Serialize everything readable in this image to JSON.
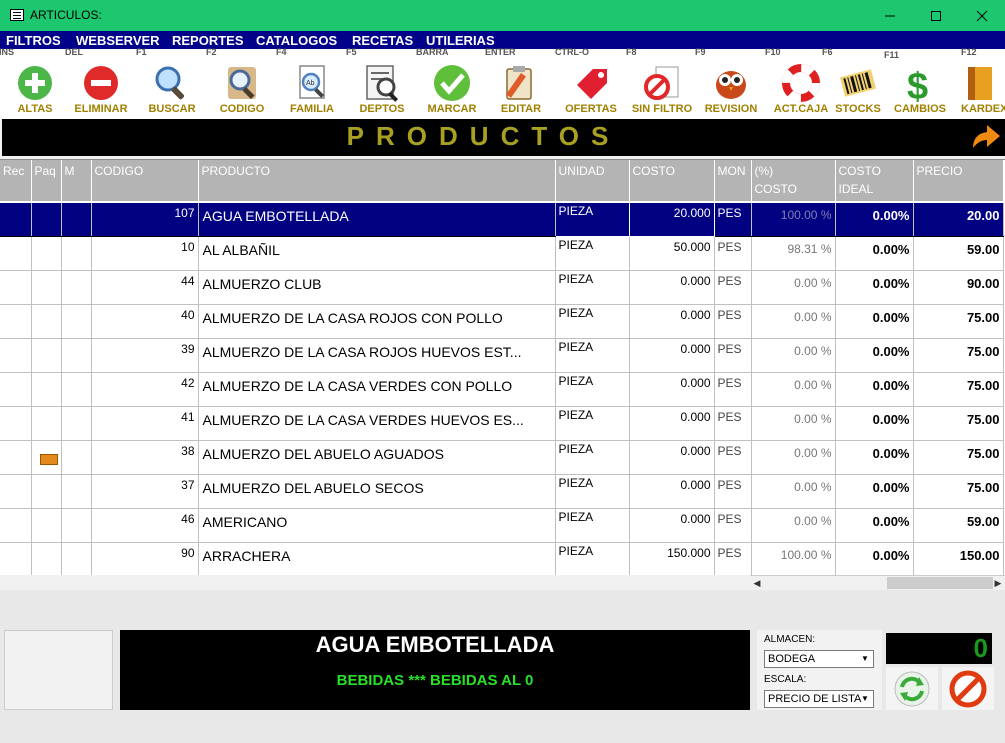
{
  "window": {
    "title": "ARTICULOS:"
  },
  "menu": [
    "FILTROS",
    "WEBSERVER",
    "REPORTES",
    "CATALOGOS",
    "RECETAS",
    "UTILERIAS"
  ],
  "toolbar": [
    {
      "key": "INS",
      "label": "ALTAS"
    },
    {
      "key": "DEL",
      "label": "ELIMINAR"
    },
    {
      "key": "F1",
      "label": "BUSCAR"
    },
    {
      "key": "F2",
      "label": "CODIGO"
    },
    {
      "key": "F4",
      "label": "FAMILIA"
    },
    {
      "key": "F5",
      "label": "DEPTOS"
    },
    {
      "key": "BARRA",
      "label": "MARCAR"
    },
    {
      "key": "ENTER",
      "label": "EDITAR"
    },
    {
      "key": "CTRL-O",
      "label": "OFERTAS"
    },
    {
      "key": "F8",
      "label": "SIN FILTRO"
    },
    {
      "key": "F9",
      "label": "REVISION"
    },
    {
      "key": "F10",
      "label": "ACT.CAJA"
    },
    {
      "key": "F6",
      "label": "STOCKS"
    },
    {
      "key": "F11",
      "label": "CAMBIOS"
    },
    {
      "key": "F12",
      "label": "KARDEX"
    }
  ],
  "header": {
    "title": "PRODUCTOS"
  },
  "columns": [
    "Rec",
    "Paq",
    "M",
    "CODIGO",
    "PRODUCTO",
    "UNIDAD",
    "COSTO",
    "MON",
    "(%)\nCOSTO",
    "COSTO\nIDEAL",
    "PRECIO"
  ],
  "rows": [
    {
      "code": "107",
      "product": "AGUA EMBOTELLADA",
      "unit": "PIEZA",
      "cost": "20.000",
      "mon": "PES",
      "pct": "100.00 %",
      "ideal": "0.00%",
      "price": "20.00",
      "pkg": false,
      "selected": true
    },
    {
      "code": "10",
      "product": "AL ALBAÑIL",
      "unit": "PIEZA",
      "cost": "50.000",
      "mon": "PES",
      "pct": "98.31 %",
      "ideal": "0.00%",
      "price": "59.00",
      "pkg": false
    },
    {
      "code": "44",
      "product": "ALMUERZO CLUB",
      "unit": "PIEZA",
      "cost": "0.000",
      "mon": "PES",
      "pct": "0.00 %",
      "ideal": "0.00%",
      "price": "90.00",
      "pkg": false
    },
    {
      "code": "40",
      "product": "ALMUERZO DE LA CASA ROJOS CON POLLO",
      "unit": "PIEZA",
      "cost": "0.000",
      "mon": "PES",
      "pct": "0.00 %",
      "ideal": "0.00%",
      "price": "75.00",
      "pkg": false
    },
    {
      "code": "39",
      "product": "ALMUERZO DE LA CASA ROJOS HUEVOS EST...",
      "unit": "PIEZA",
      "cost": "0.000",
      "mon": "PES",
      "pct": "0.00 %",
      "ideal": "0.00%",
      "price": "75.00",
      "pkg": false
    },
    {
      "code": "42",
      "product": "ALMUERZO DE LA CASA VERDES CON POLLO",
      "unit": "PIEZA",
      "cost": "0.000",
      "mon": "PES",
      "pct": "0.00 %",
      "ideal": "0.00%",
      "price": "75.00",
      "pkg": false
    },
    {
      "code": "41",
      "product": "ALMUERZO DE LA CASA VERDES HUEVOS ES...",
      "unit": "PIEZA",
      "cost": "0.000",
      "mon": "PES",
      "pct": "0.00 %",
      "ideal": "0.00%",
      "price": "75.00",
      "pkg": false
    },
    {
      "code": "38",
      "product": "ALMUERZO DEL ABUELO AGUADOS",
      "unit": "PIEZA",
      "cost": "0.000",
      "mon": "PES",
      "pct": "0.00 %",
      "ideal": "0.00%",
      "price": "75.00",
      "pkg": true
    },
    {
      "code": "37",
      "product": "ALMUERZO DEL ABUELO SECOS",
      "unit": "PIEZA",
      "cost": "0.000",
      "mon": "PES",
      "pct": "0.00 %",
      "ideal": "0.00%",
      "price": "75.00",
      "pkg": false
    },
    {
      "code": "46",
      "product": "AMERICANO",
      "unit": "PIEZA",
      "cost": "0.000",
      "mon": "PES",
      "pct": "0.00 %",
      "ideal": "0.00%",
      "price": "59.00",
      "pkg": false
    },
    {
      "code": "90",
      "product": "ARRACHERA",
      "unit": "PIEZA",
      "cost": "150.000",
      "mon": "PES",
      "pct": "100.00 %",
      "ideal": "0.00%",
      "price": "150.00",
      "pkg": false
    }
  ],
  "detail": {
    "name": "AGUA EMBOTELLADA",
    "category": "BEBIDAS *** BEBIDAS AL 0"
  },
  "almacen": {
    "label": "ALMACEN:",
    "value": "BODEGA"
  },
  "escala": {
    "label": "ESCALA:",
    "value": "PRECIO DE LISTA"
  },
  "counter": "0",
  "colors": {
    "titlebar": "#1dc76f",
    "menubar": "#02018a",
    "selection": "#010182",
    "header_text": "#a8a020",
    "category_text": "#28e028"
  }
}
